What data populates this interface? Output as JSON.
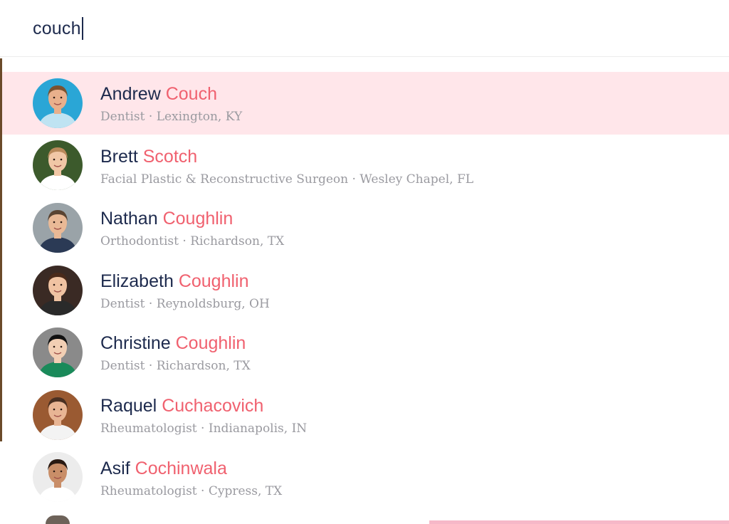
{
  "search": {
    "value": "couch"
  },
  "results": [
    {
      "first_name": "Andrew",
      "last_name": "Couch",
      "specialty": "Dentist",
      "location": "Lexington, KY",
      "highlighted": true,
      "avatar": {
        "bg": "#2aa6d6",
        "skin": "#e8b08c",
        "hair": "#7a5230",
        "shirt": "#bfe3f2"
      }
    },
    {
      "first_name": "Brett",
      "last_name": "Scotch",
      "specialty": "Facial Plastic & Reconstructive Surgeon",
      "location": "Wesley Chapel, FL",
      "highlighted": false,
      "avatar": {
        "bg": "#3c5a2c",
        "skin": "#f1c7a6",
        "hair": "#b8895a",
        "shirt": "#ffffff"
      }
    },
    {
      "first_name": "Nathan",
      "last_name": "Coughlin",
      "specialty": "Orthodontist",
      "location": "Richardson, TX",
      "highlighted": false,
      "avatar": {
        "bg": "#9aa3a8",
        "skin": "#e9b996",
        "hair": "#5a4432",
        "shirt": "#2b3a55"
      }
    },
    {
      "first_name": "Elizabeth",
      "last_name": "Coughlin",
      "specialty": "Dentist",
      "location": "Reynoldsburg, OH",
      "highlighted": false,
      "avatar": {
        "bg": "#3a2a24",
        "skin": "#f0c3a2",
        "hair": "#4a2a1a",
        "shirt": "#2a2a2a"
      }
    },
    {
      "first_name": "Christine",
      "last_name": "Coughlin",
      "specialty": "Dentist",
      "location": "Richardson, TX",
      "highlighted": false,
      "avatar": {
        "bg": "#8a8a8a",
        "skin": "#f2cfb4",
        "hair": "#111111",
        "shirt": "#1a8a5a"
      }
    },
    {
      "first_name": "Raquel",
      "last_name": "Cuchacovich",
      "specialty": "Rheumatologist",
      "location": "Indianapolis, IN",
      "highlighted": false,
      "avatar": {
        "bg": "#9a5a32",
        "skin": "#e8b594",
        "hair": "#4a3022",
        "shirt": "#f3f3f3"
      }
    },
    {
      "first_name": "Asif",
      "last_name": "Cochinwala",
      "specialty": "Rheumatologist",
      "location": "Cypress, TX",
      "highlighted": false,
      "avatar": {
        "bg": "#ececec",
        "skin": "#c98e68",
        "hair": "#2a1a12",
        "shirt": "#ffffff"
      }
    }
  ],
  "colors": {
    "name": "#1d2a4d",
    "match": "#f0616f",
    "detail": "#9a9aa0",
    "highlight_row": "#ffe6ea"
  }
}
